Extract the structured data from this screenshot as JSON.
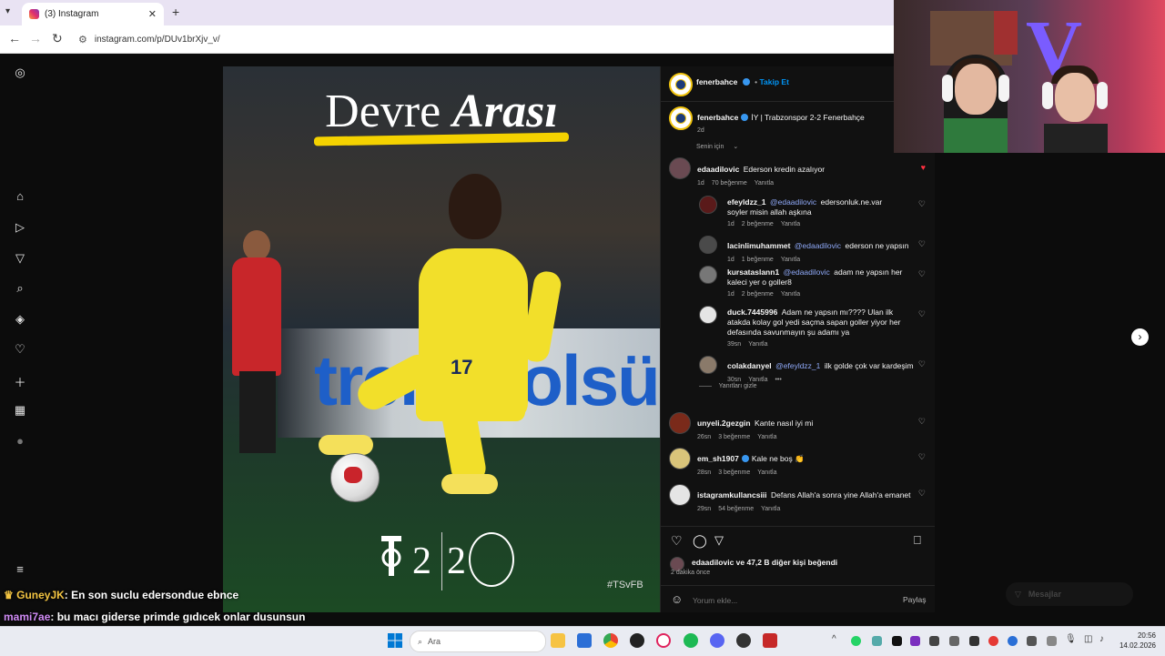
{
  "browser": {
    "tab_title": "(3) Instagram",
    "url": "instagram.com/p/DUv1brXjv_v/"
  },
  "post": {
    "title_plain": "Devre",
    "title_italic": "Arası",
    "banner_text": "trendyolsü",
    "jersey_number": "17",
    "score_home": "2",
    "score_away": "2",
    "hashtag": "#TSvFB"
  },
  "panel": {
    "header": {
      "username": "fenerbahce",
      "follow_label": "Takip Et"
    },
    "caption": {
      "username": "fenerbahce",
      "text": "İY | Trabzonspor 2-2 Fenerbahçe",
      "time": "2d"
    },
    "sort_label": "Senin için",
    "comments": [
      {
        "user": "edaadilovic",
        "text": "Ederson kredin azalıyor",
        "time": "1d",
        "likes": "70 beğenme",
        "reply": "Yanıtla"
      },
      {
        "user": "efeyldzz_1",
        "mention": "@edaadilovic",
        "text": "edersonluk.ne.var soyler misin allah aşkına",
        "time": "1d",
        "likes": "2 beğenme",
        "reply": "Yanıtla"
      },
      {
        "user": "lacinlimuhammet",
        "mention": "@edaadilovic",
        "text": "ederson ne yapsın",
        "time": "1d",
        "likes": "1 beğenme",
        "reply": "Yanıtla"
      },
      {
        "user": "kursataslann1",
        "mention": "@edaadilovic",
        "text": "adam ne yapsın her kaleci yer o goller8",
        "time": "1d",
        "likes": "2 beğenme",
        "reply": "Yanıtla"
      },
      {
        "user": "duck.7445996",
        "text": "Adam ne yapsın mı???? Ulan ilk atakda kolay gol yedi saçma sapan goller yiyor her defasında savunmayın şu adamı ya",
        "time": "39sn",
        "reply": "Yanıtla"
      },
      {
        "user": "colakdanyel",
        "mention": "@efeyldzz_1",
        "text": "ilk golde çok var kardeşim",
        "time": "30sn",
        "reply": "Yanıtla"
      },
      {
        "user": "unyeli.2gezgin",
        "text": "Kante nasıl iyi mi",
        "time": "26sn",
        "likes": "3 beğenme",
        "reply": "Yanıtla"
      },
      {
        "user": "em_sh1907",
        "text": "Kale ne boş 👏",
        "time": "28sn",
        "likes": "3 beğenme",
        "reply": "Yanıtla"
      },
      {
        "user": "istagramkullancsiii",
        "text": "Defans Allah'a sonra yine Allah'a emanet",
        "time": "29sn",
        "likes": "54 beğenme",
        "reply": "Yanıtla"
      }
    ],
    "hide_replies": "Yanıtları gizle",
    "likes_text": "edaadilovic ve 47,2 B diğer kişi beğendi",
    "post_time": "2 dakika önce",
    "comment_placeholder": "Yorum ekle...",
    "share_label": "Paylaş"
  },
  "messages_label": "Mesajlar",
  "chat": [
    {
      "user": "GuneyJK",
      "text": ": En son suclu edersondue ebnce"
    },
    {
      "user": "mami7ae",
      "text": ": bu macı giderse primde gıdıcek onlar dusunsun"
    }
  ],
  "taskbar": {
    "search_placeholder": "Ara",
    "time": "20:56",
    "date": "14.02.2026"
  },
  "colors": {
    "accent_blue": "#0095f6",
    "mention": "#8fa9f8",
    "like_red": "#ff3040",
    "fener_yellow": "#f2df2a"
  }
}
